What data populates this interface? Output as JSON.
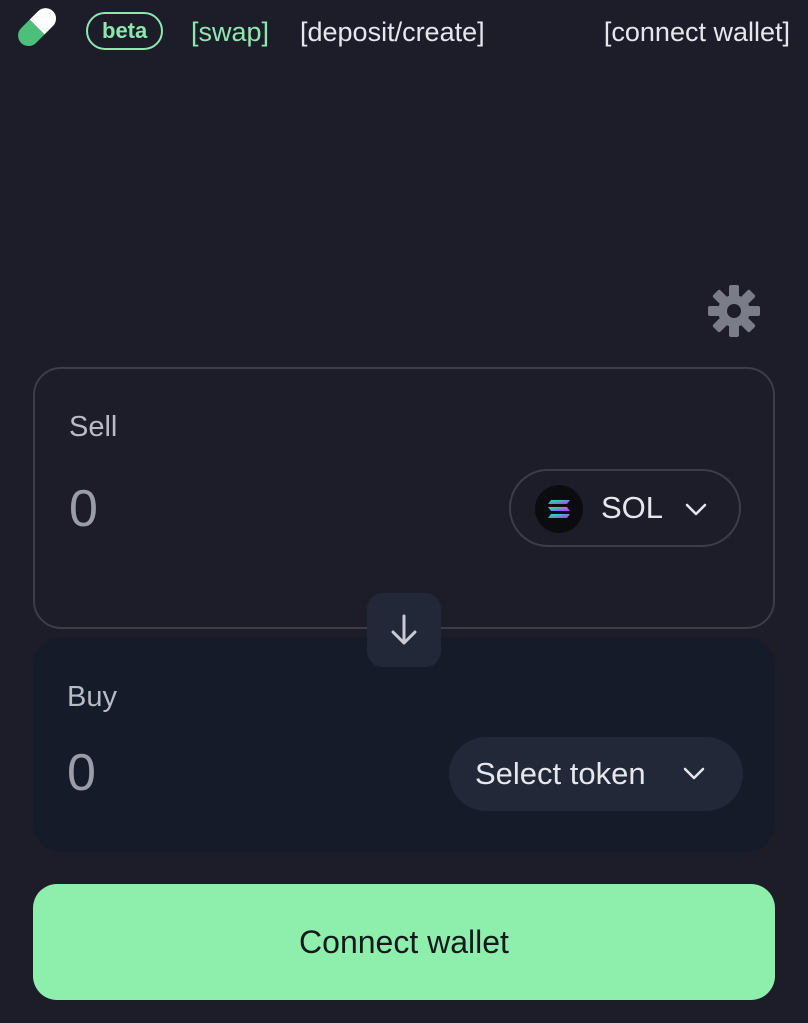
{
  "header": {
    "logo_icon": "pill-icon",
    "badge": "beta",
    "nav": {
      "swap": "[swap]",
      "deposit_create": "[deposit/create]",
      "connect_wallet": "[connect wallet]"
    }
  },
  "settings": {
    "icon": "gear-icon"
  },
  "sell": {
    "label": "Sell",
    "amount_placeholder": "0",
    "token": {
      "symbol": "SOL",
      "icon": "solana-logo-icon"
    }
  },
  "swap_direction": {
    "icon": "arrow-down-icon"
  },
  "buy": {
    "label": "Buy",
    "amount_placeholder": "0",
    "token_select_label": "Select token"
  },
  "connect_button": {
    "label": "Connect wallet"
  },
  "colors": {
    "background": "#1c1d28",
    "accent_green": "#8ee7ad",
    "button_green": "#8eeeac",
    "buy_card_bg": "#151b29",
    "pill_bg": "#222838",
    "border": "#3b3d4a",
    "text": "#e6e7ec",
    "muted_text": "#b8bac4"
  }
}
